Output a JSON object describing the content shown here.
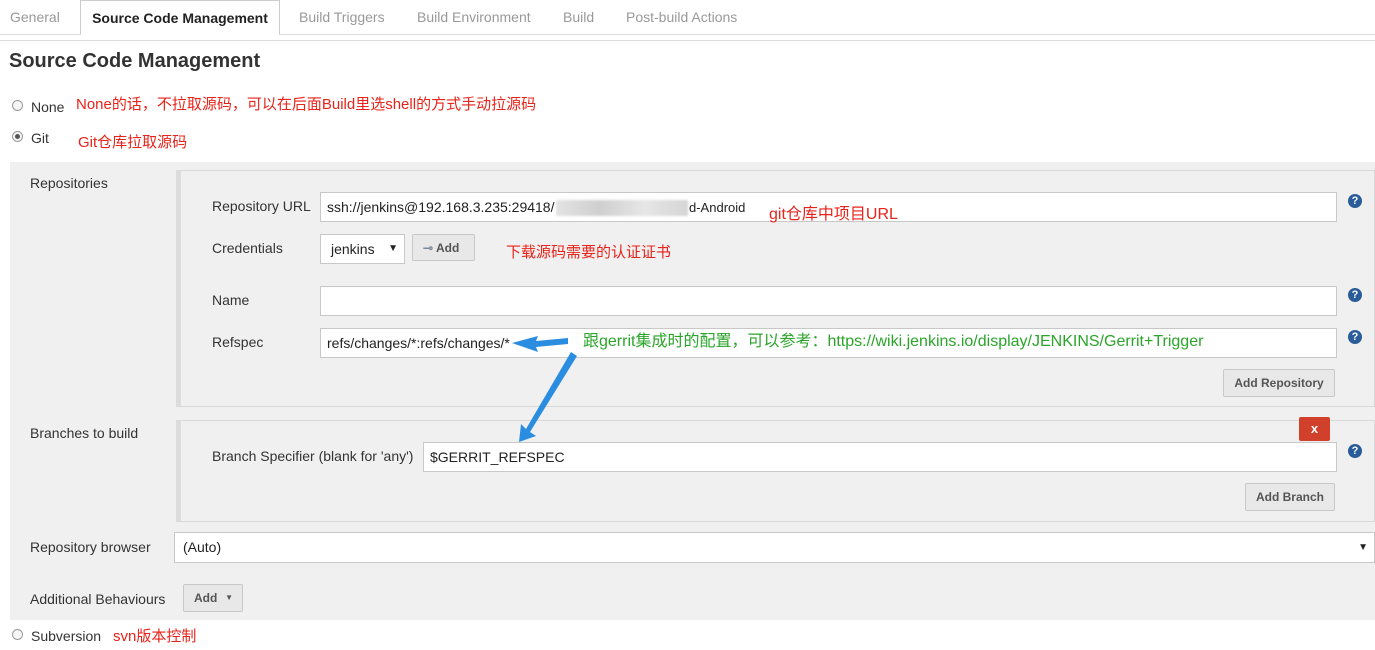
{
  "tabs": [
    {
      "label": "General"
    },
    {
      "label": "Source Code Management"
    },
    {
      "label": "Build Triggers"
    },
    {
      "label": "Build Environment"
    },
    {
      "label": "Build"
    },
    {
      "label": "Post-build Actions"
    }
  ],
  "section_title": "Source Code Management",
  "scm_options": {
    "none": {
      "label": "None",
      "note": "None的话，不拉取源码，可以在后面Build里选shell的方式手动拉源码"
    },
    "git": {
      "label": "Git",
      "note": "Git仓库拉取源码"
    },
    "subversion": {
      "label": "Subversion",
      "note": "svn版本控制"
    }
  },
  "repositories": {
    "label": "Repositories",
    "repo_url_label": "Repository URL",
    "repo_url_prefix": "ssh://jenkins@192.168.3.235:29418/",
    "repo_url_suffix": "d-Android",
    "repo_url_note": "git仓库中项目URL",
    "credentials_label": "Credentials",
    "credentials_value": "jenkins",
    "credentials_add": "Add",
    "credentials_note": "下载源码需要的认证证书",
    "name_label": "Name",
    "name_value": "",
    "refspec_label": "Refspec",
    "refspec_value": "refs/changes/*:refs/changes/*",
    "refspec_note": "跟gerrit集成时的配置，可以参考：https://wiki.jenkins.io/display/JENKINS/Gerrit+Trigger",
    "add_repository": "Add Repository"
  },
  "branches": {
    "label": "Branches to build",
    "specifier_label": "Branch Specifier (blank for 'any')",
    "specifier_value": "$GERRIT_REFSPEC",
    "delete_label": "x",
    "add_branch": "Add Branch"
  },
  "repo_browser": {
    "label": "Repository browser",
    "value": "(Auto)"
  },
  "additional": {
    "label": "Additional Behaviours",
    "add": "Add"
  },
  "colors": {
    "annotation_red": "#e8231a",
    "annotation_green": "#2aa52a",
    "arrow_blue": "#2b8de0",
    "delete_red": "#d0402a",
    "help_blue": "#2a5c9a"
  }
}
